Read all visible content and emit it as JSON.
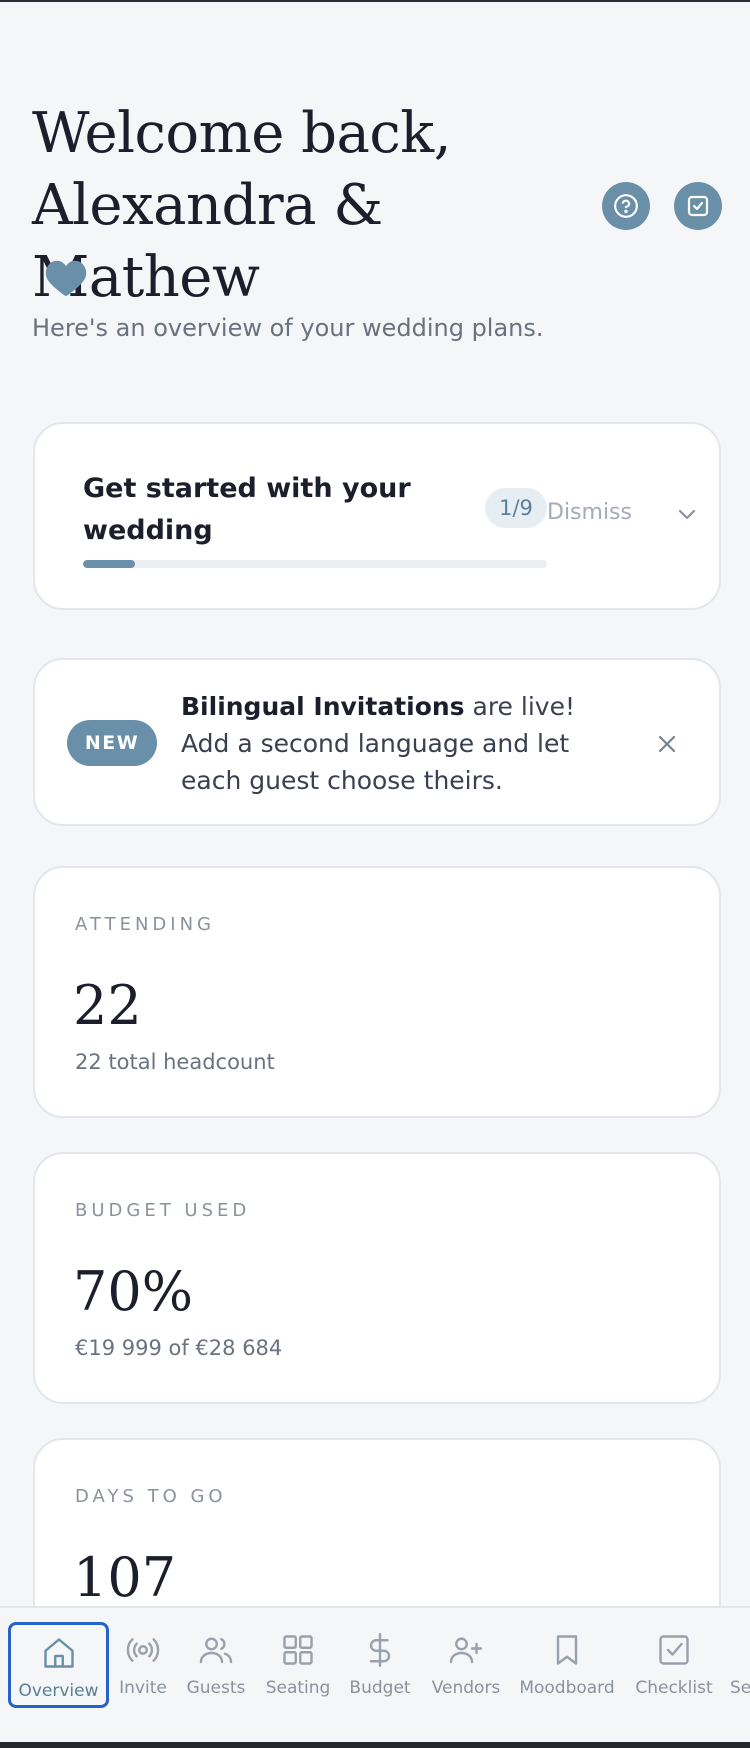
{
  "header": {
    "welcome_line1": "Welcome back,",
    "welcome_line2": "Alexandra & Mathew",
    "subtitle": "Here's an overview of your wedding plans.",
    "help_icon": "help-circle-icon",
    "checklist_icon": "check-square-icon",
    "heart_icon": "heart-icon"
  },
  "get_started": {
    "title": "Get started with your wedding",
    "count": "1/9",
    "progress": 0.111,
    "dismiss_label": "Dismiss"
  },
  "announcement": {
    "badge": "NEW",
    "bold": "Bilingual Invitations",
    "text": " are live! Add a second language and let each guest choose theirs."
  },
  "stats": [
    {
      "label": "ATTENDING",
      "value": "22",
      "sub": "22 total headcount"
    },
    {
      "label": "BUDGET USED",
      "value": "70%",
      "sub": "€19 999 of €28 684"
    },
    {
      "label": "DAYS TO GO",
      "value": "107",
      "sub": ""
    }
  ],
  "nav": {
    "items": [
      {
        "label": "Overview",
        "icon": "home-icon",
        "active": true
      },
      {
        "label": "Invite",
        "icon": "broadcast-icon"
      },
      {
        "label": "Guests",
        "icon": "users-icon"
      },
      {
        "label": "Seating",
        "icon": "grid-icon"
      },
      {
        "label": "Budget",
        "icon": "dollar-icon"
      },
      {
        "label": "Vendors",
        "icon": "user-plus-icon"
      },
      {
        "label": "Moodboard",
        "icon": "bookmark-icon"
      },
      {
        "label": "Checklist",
        "icon": "check-square-icon"
      },
      {
        "label": "Se"
      }
    ]
  },
  "colors": {
    "accent": "#6a8fa8",
    "background": "#f4f6f8",
    "focus_ring": "#2563c8"
  }
}
